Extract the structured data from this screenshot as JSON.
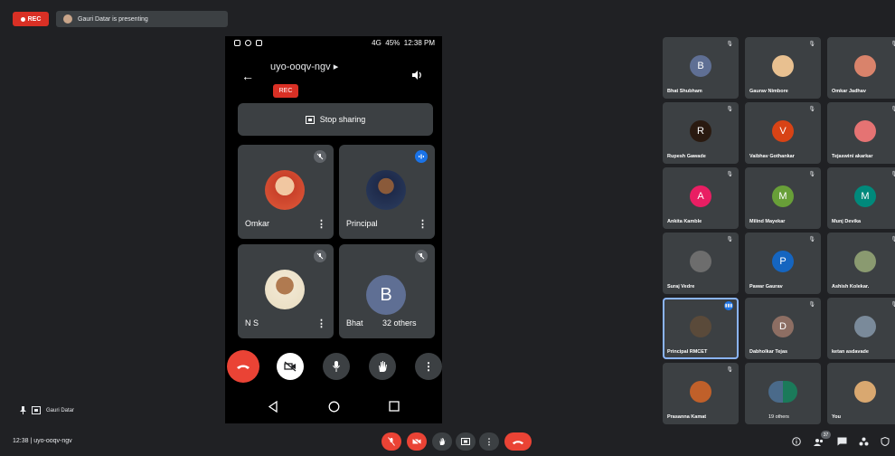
{
  "top_bar": {
    "rec_label": "REC",
    "presenting_text": "Gauri Datar is presenting"
  },
  "phone": {
    "status_time": "12:38 PM",
    "status_battery": "45%",
    "status_network": "4G",
    "meeting_code": "uyo-ooqv-ngv ▸",
    "rec_badge": "REC",
    "stop_sharing": "Stop sharing",
    "tiles": [
      {
        "name": "Omkar",
        "state": "muted"
      },
      {
        "name": "Principal",
        "state": "speaking"
      },
      {
        "name": "N S",
        "state": "muted"
      },
      {
        "name": "Bhat",
        "extra": "32 others",
        "initial": "B",
        "state": "muted"
      }
    ]
  },
  "grid": [
    {
      "name": "Bhat Shubham",
      "initial": "B",
      "color": "#5f6f94"
    },
    {
      "name": "Gaurav Nimbore",
      "initial": "",
      "color": "#e8c090"
    },
    {
      "name": "Omkar Jadhav",
      "initial": "",
      "color": "#d9836b"
    },
    {
      "name": "Rupesh Gawade",
      "initial": "R",
      "color": "#2a1a10"
    },
    {
      "name": "Vaibhav Gothankar",
      "initial": "V",
      "color": "#d84315"
    },
    {
      "name": "Tejaswini akarkar",
      "initial": "",
      "color": "#e57373"
    },
    {
      "name": "Ankita Kamble",
      "initial": "A",
      "color": "#e91e63"
    },
    {
      "name": "Milind Mayekar",
      "initial": "M",
      "color": "#689f38"
    },
    {
      "name": "Munj Devika",
      "initial": "M",
      "color": "#00897b"
    },
    {
      "name": "Suraj Vedre",
      "initial": "",
      "color": "#6d6d6d"
    },
    {
      "name": "Pawar Gaurav",
      "initial": "P",
      "color": "#1565c0"
    },
    {
      "name": "Ashish Kolekar.",
      "initial": "",
      "color": "#8a9a70"
    },
    {
      "name": "Principal RMCET",
      "initial": "",
      "color": "#5a4a3a"
    },
    {
      "name": "Dabholkar Tejas",
      "initial": "D",
      "color": "#8d6e63"
    },
    {
      "name": "ketan asdavade",
      "initial": "",
      "color": "#7a8a9a"
    },
    {
      "name": "Prasanna Kamat",
      "initial": "",
      "color": "#c0602a"
    },
    {
      "name": "19 others",
      "initial": "",
      "color": "#3c4043"
    },
    {
      "name": "You",
      "initial": "",
      "color": "#d9a870"
    }
  ],
  "bottom_bar": {
    "time_code": "12:38  |  uyo-ooqv-ngv",
    "presenter": "Gauri Datar",
    "participants_count": "37"
  },
  "colors": {
    "bg": "#202124",
    "tile": "#3c4043",
    "red": "#d93025",
    "blue": "#1a73e8"
  }
}
